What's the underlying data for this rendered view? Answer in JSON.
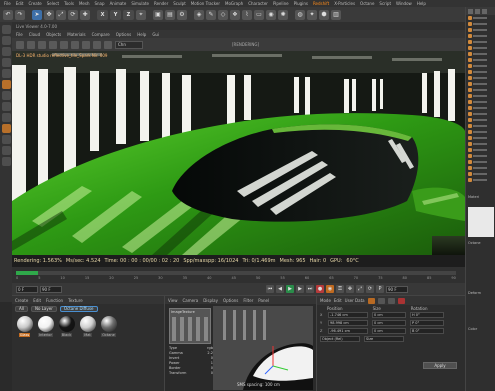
{
  "menubar": {
    "items": [
      "File",
      "Edit",
      "Create",
      "Select",
      "Tools",
      "Mesh",
      "Snap",
      "Animate",
      "Simulate",
      "Render",
      "Sculpt",
      "Motion Tracker",
      "MoGraph",
      "Character",
      "Pipeline",
      "Plugins",
      "Redshift",
      "X-Particles",
      "Octane",
      "Script",
      "Window",
      "Help"
    ],
    "active_item": "Redshift"
  },
  "toolbar": {
    "xyz": [
      "X",
      "Y",
      "Z"
    ]
  },
  "viewport": {
    "window_title": "Live Viewer 4.0-7.00",
    "menus": [
      "File",
      "Cloud",
      "Objects",
      "Materials",
      "Compare",
      "Options",
      "Help",
      "Gui"
    ],
    "center_label": "[RENDERING]",
    "channel_select": "Chn",
    "render_path": "DL-3 HDR studio reflective_tile_Spark Nir. 009"
  },
  "statusline": {
    "rendering": "Rendering: 1.563%",
    "msec": "Ms/sec: 4.524",
    "time": "Time: 00 : 00 : 00/00 : 02 : 20",
    "spp": "Spp/maxspp: 16/1024",
    "tri": "Tri: 0/1.469m",
    "mesh": "Mesh: 965",
    "hair": "Hair: 0",
    "gpu": "GPU:",
    "temp": "60°C"
  },
  "timeline": {
    "ticks": [
      "0",
      "5",
      "10",
      "15",
      "20",
      "25",
      "30",
      "35",
      "40",
      "45",
      "50",
      "55",
      "60",
      "65",
      "70",
      "75",
      "80",
      "85",
      "90"
    ],
    "progress": 0.05
  },
  "playback": {
    "start": "0 F",
    "current": "90 F",
    "end": "90 F"
  },
  "material_manager": {
    "menus": [
      "Create",
      "Edit",
      "Function",
      "Texture"
    ],
    "filters": [
      "All",
      "No Layer",
      "Octane Diffuse"
    ],
    "active_filter": "Octane Diffuse",
    "materials": [
      {
        "name": "Glass",
        "color": "#c9c9c9"
      },
      {
        "name": "Interior",
        "color": "#f2f2f2"
      },
      {
        "name": "Black",
        "color": "#141414"
      },
      {
        "name": "Mat",
        "color": "#d0d0d0"
      },
      {
        "name": "Octane",
        "color": "#6d6d6d"
      }
    ],
    "selected_material": "Glass"
  },
  "node_editor": {
    "menus": [
      "View",
      "Camera",
      "Display",
      "Options",
      "Filter",
      "Panel"
    ],
    "node_title": "ImageTexture",
    "params": [
      {
        "k": "Type",
        "v": "rgb"
      },
      {
        "k": "Gamma",
        "v": "2.2"
      },
      {
        "k": "Invert",
        "v": "0"
      },
      {
        "k": "Power",
        "v": "1"
      },
      {
        "k": "Border",
        "v": "0"
      },
      {
        "k": "Transform",
        "v": "0"
      }
    ],
    "preview_label": "SMS spacing: 100 cm"
  },
  "attributes": {
    "menus": [
      "Mode",
      "Edit",
      "User Data"
    ],
    "columns": [
      "Position",
      "Size",
      "Rotation"
    ],
    "rows": [
      {
        "axis": "X",
        "pos": "-1.746 cm",
        "size": "0 cm",
        "rot": "H 0°"
      },
      {
        "axis": "Y",
        "pos": "98.998 cm",
        "size": "0 cm",
        "rot": "P 0°"
      },
      {
        "axis": "Z",
        "pos": "-96.491 cm",
        "size": "0 cm",
        "rot": "B 0°"
      }
    ],
    "mode": "Object (Rel)",
    "size_mode": "Size",
    "apply_label": "Apply"
  },
  "right_panel": {
    "labels": [
      "Materi",
      "Octane",
      "Deform",
      "Color"
    ]
  },
  "colors": {
    "accent": "#ff8c1a",
    "timeline_progress": "#2fa84a",
    "car_paint": "#3fae1c"
  }
}
